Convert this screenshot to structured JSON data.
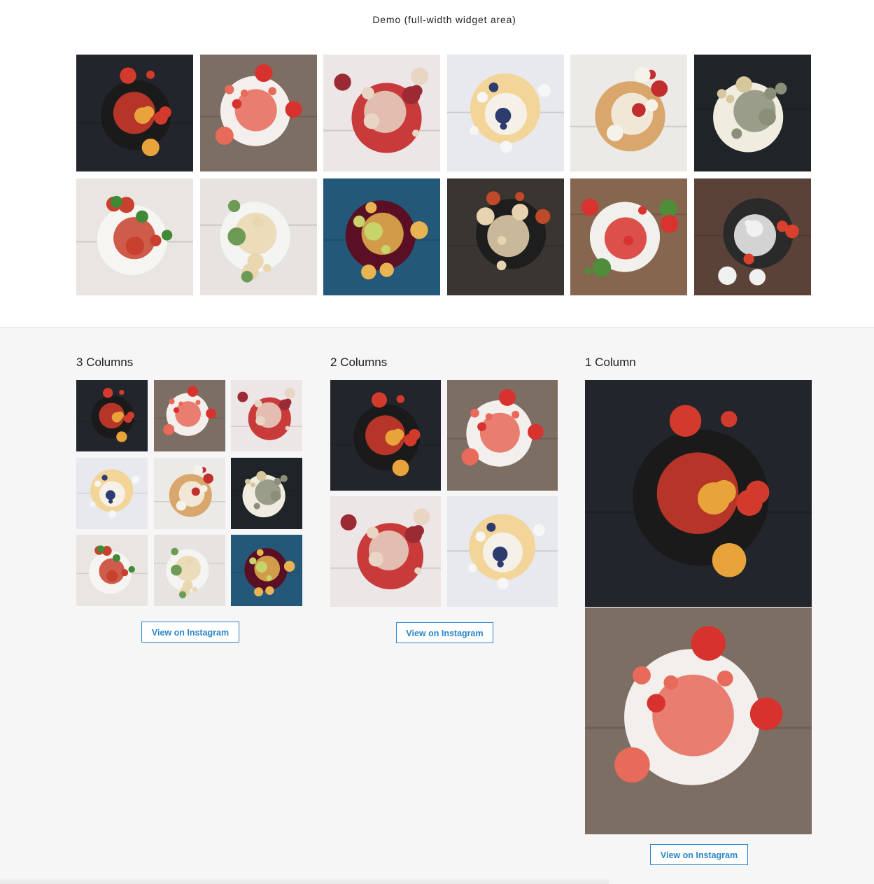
{
  "demo": {
    "title": "Demo (full-width widget area)"
  },
  "photos": [
    {
      "name": "eggs-pan",
      "bg": "#22252b",
      "plate": "#1a1a1a",
      "accent": "#e8a43a",
      "accent2": "#d23b2c"
    },
    {
      "name": "strawberry-plate",
      "bg": "#7d6e63",
      "plate": "#f2efec",
      "accent": "#d8322f",
      "accent2": "#e86a5a"
    },
    {
      "name": "cherry-pie",
      "bg": "#ece6e6",
      "plate": "#c93a3a",
      "accent": "#9c2a35",
      "accent2": "#e8d5c4"
    },
    {
      "name": "blueberry-parfait",
      "bg": "#e7e9ee",
      "plate": "#f3d59a",
      "accent": "#2d3b6e",
      "accent2": "#f6f6f6"
    },
    {
      "name": "pancakes",
      "bg": "#ebeae6",
      "plate": "#d9a66b",
      "accent": "#c22d2d",
      "accent2": "#f5f2ea"
    },
    {
      "name": "pasta-bowl",
      "bg": "#1f2428",
      "plate": "#f0ece0",
      "accent": "#d7c79c",
      "accent2": "#8b8f7a"
    },
    {
      "name": "bacon-salad",
      "bg": "#e9e6e2",
      "plate": "#f7f5f2",
      "accent": "#3f8a36",
      "accent2": "#c8402e"
    },
    {
      "name": "greens-plates",
      "bg": "#e6e3e0",
      "plate": "#f4f4f2",
      "accent": "#6d9b55",
      "accent2": "#ead7b0"
    },
    {
      "name": "red-drink",
      "bg": "#245878",
      "plate": "#5a0f25",
      "accent": "#c7d46a",
      "accent2": "#e7b451"
    },
    {
      "name": "campfire-pan",
      "bg": "#3a3530",
      "plate": "#1e1e1e",
      "accent": "#c0492a",
      "accent2": "#e7d3b0"
    },
    {
      "name": "arugula-plate",
      "bg": "#86664f",
      "plate": "#f2f0ec",
      "accent": "#4f8d3a",
      "accent2": "#d9332f"
    },
    {
      "name": "strawberry-toast",
      "bg": "#5a4239",
      "plate": "#2a2a2a",
      "accent": "#d9412e",
      "accent2": "#f1f1f1"
    }
  ],
  "sections": {
    "three": {
      "title": "3 Columns",
      "button": "View on Instagram"
    },
    "two": {
      "title": "2 Columns",
      "button": "View on Instagram"
    },
    "one": {
      "title": "1 Column",
      "button": "View on Instagram"
    }
  },
  "icons": {
    "photo": "photo-thumbnail"
  }
}
